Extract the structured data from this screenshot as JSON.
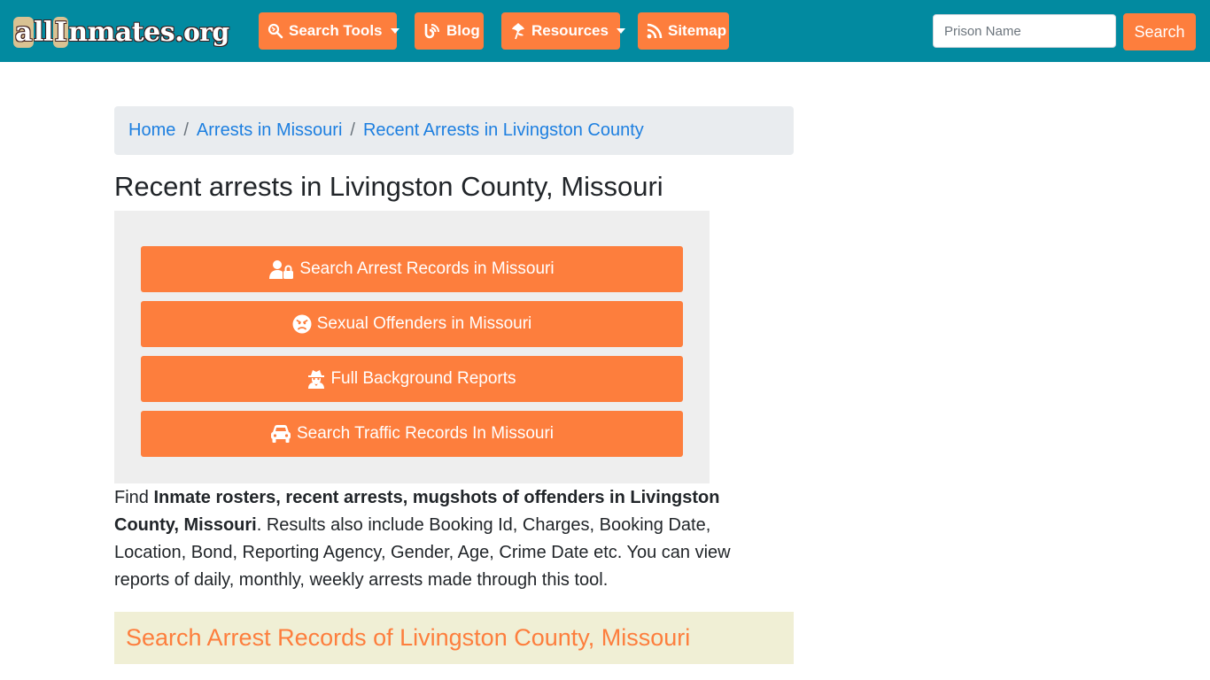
{
  "header": {
    "logo_parts": {
      "a": "a",
      "ll": "ll",
      "i": "I",
      "rest": "nmates.",
      "org": "org"
    },
    "nav": [
      {
        "label": "Search Tools",
        "icon": "search-icon",
        "dropdown": true
      },
      {
        "label": "Blog",
        "icon": "blog-icon",
        "dropdown": false
      },
      {
        "label": "Resources",
        "icon": "leaf-icon",
        "dropdown": true
      },
      {
        "label": "Sitemap",
        "icon": "rss-icon",
        "dropdown": false
      }
    ],
    "search": {
      "placeholder": "Prison Name",
      "value": "",
      "button_label": "Search"
    }
  },
  "breadcrumb": {
    "items": [
      {
        "label": "Home"
      },
      {
        "label": "Arrests in Missouri"
      },
      {
        "label": "Recent Arrests in Livingston County"
      }
    ],
    "separator": "/"
  },
  "main": {
    "title": "Recent arrests in Livingston County, Missouri",
    "buttons": [
      {
        "label": "Search Arrest Records in Missouri",
        "icon": "user-lock-icon"
      },
      {
        "label": "Sexual Offenders in Missouri",
        "icon": "angry-face-icon"
      },
      {
        "label": "Full Background Reports",
        "icon": "user-secret-icon"
      },
      {
        "label": "Search Traffic Records In Missouri",
        "icon": "car-icon"
      }
    ],
    "intro": {
      "prefix": "Find ",
      "bold": "Inmate rosters, recent arrests, mugshots of offenders in Livingston County, Missouri",
      "suffix": ". Results also include Booking Id, Charges, Booking Date, Location, Bond, Reporting Agency, Gender, Age, Crime Date etc. You can view reports of daily, monthly, weekly arrests made through this tool."
    },
    "section_heading": "Search Arrest Records of Livingston County, Missouri"
  },
  "colors": {
    "header_bg": "#028aa0",
    "accent": "#fd7e3d",
    "link": "#1d7fe0",
    "section_bg": "#f0efd5"
  }
}
